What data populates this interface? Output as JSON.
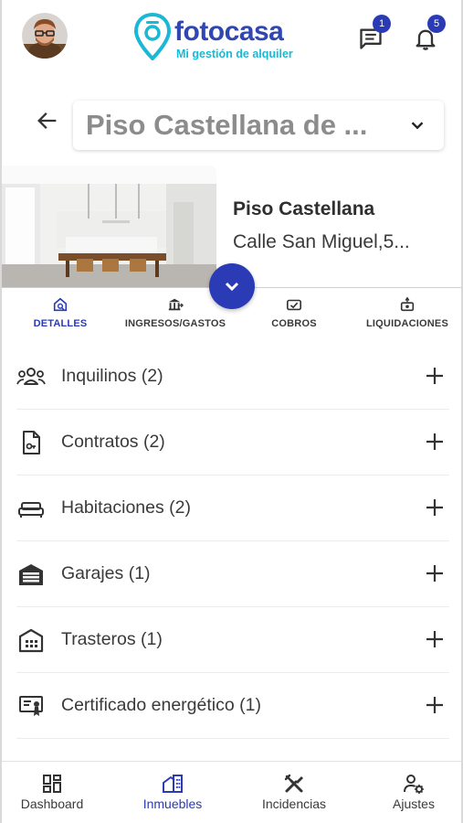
{
  "header": {
    "brand_name": "fotocasa",
    "brand_tagline": "Mi gestión de alquiler",
    "messages_badge": "1",
    "notifications_badge": "5",
    "icons": [
      "avatar",
      "chat-icon",
      "bell-icon"
    ]
  },
  "selector": {
    "title": "Piso Castellana de ...",
    "icons": [
      "back-arrow-icon",
      "chevron-down-icon"
    ]
  },
  "property": {
    "name": "Piso Castellana",
    "address": "Calle San Miguel,5..."
  },
  "tabs": [
    {
      "label": "DETALLES",
      "icon": "house-search-icon",
      "active": true
    },
    {
      "label": "INGRESOS/GASTOS",
      "icon": "bank-icon",
      "active": false
    },
    {
      "label": "COBROS",
      "icon": "payment-icon",
      "active": false
    },
    {
      "label": "LIQUIDACIONES",
      "icon": "settlement-icon",
      "active": false
    }
  ],
  "list": [
    {
      "label": "Inquilinos (2)",
      "icon": "group-icon"
    },
    {
      "label": "Contratos (2)",
      "icon": "contract-icon"
    },
    {
      "label": "Habitaciones (2)",
      "icon": "bed-icon"
    },
    {
      "label": "Garajes (1)",
      "icon": "garage-icon"
    },
    {
      "label": "Trasteros (1)",
      "icon": "storage-icon"
    },
    {
      "label": "Certificado energético (1)",
      "icon": "energy-certificate-icon"
    }
  ],
  "bottom_nav": [
    {
      "label": "Dashboard",
      "icon": "dashboard-icon",
      "active": false
    },
    {
      "label": "Inmuebles",
      "icon": "buildings-icon",
      "active": true
    },
    {
      "label": "Incidencias",
      "icon": "tools-icon",
      "active": false
    },
    {
      "label": "Ajustes",
      "icon": "user-settings-icon",
      "active": false
    }
  ],
  "colors": {
    "primary": "#2b3bb5",
    "brand_blue": "#2f46b3",
    "brand_cyan": "#19b8d6",
    "text": "#3a3a3a"
  }
}
